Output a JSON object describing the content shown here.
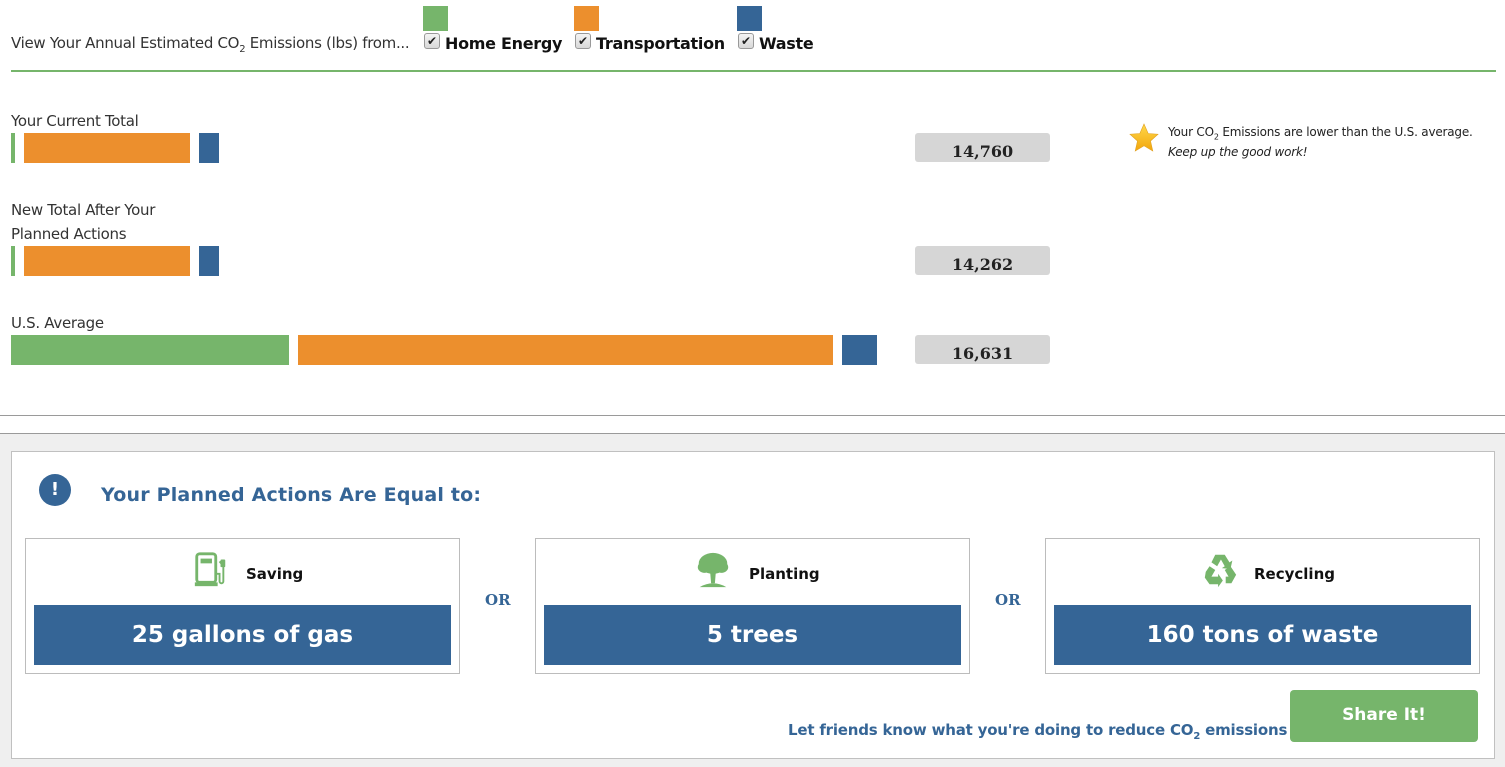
{
  "header": {
    "title_prefix": "View Your Annual Estimated CO",
    "title_sub": "2",
    "title_suffix": " Emissions (lbs) from...",
    "categories": [
      {
        "label": "Home Energy",
        "color": "#76b56b",
        "checked": true
      },
      {
        "label": "Transportation",
        "color": "#ec8f2d",
        "checked": true
      },
      {
        "label": "Waste",
        "color": "#356596",
        "checked": true
      }
    ],
    "checkmark": "✔"
  },
  "chart_data": {
    "type": "bar",
    "title": "Annual Estimated CO2 Emissions (lbs)",
    "series_names": [
      "Home Energy",
      "Transportation",
      "Waste"
    ],
    "colors": [
      "#76b56b",
      "#ec8f2d",
      "#356596"
    ],
    "rows": [
      {
        "label_lines": [
          "Your Current Total"
        ],
        "total": "14,760",
        "segments": [
          0.014,
          0.31,
          0.57
        ]
      },
      {
        "label_lines": [
          "New Total After Your",
          "Planned Actions"
        ],
        "total": "14,262",
        "segments": [
          0.014,
          0.31,
          0.57
        ]
      },
      {
        "label_lines": [
          "U.S. Average"
        ],
        "total": "16,631",
        "segments": [
          1.0,
          1.0,
          1.0
        ]
      }
    ],
    "segments_note": "segment lengths relative to U.S. average per category"
  },
  "note": {
    "line1_prefix": "Your CO",
    "line1_sub": "2",
    "line1_suffix": " Emissions are lower than the U.S. average.",
    "line2": "Keep up the good work!"
  },
  "equivalents": {
    "title": "Your Planned Actions Are Equal to:",
    "info_glyph": "!",
    "or_label": "OR",
    "cards": [
      {
        "icon": "gas-pump-icon",
        "caption": "Saving",
        "value": "25 gallons of gas"
      },
      {
        "icon": "tree-icon",
        "caption": "Planting",
        "value": "5 trees"
      },
      {
        "icon": "recycle-icon",
        "caption": "Recycling",
        "value": "160 tons of waste"
      }
    ],
    "share_prefix": "Let friends know what you're doing to reduce CO",
    "share_sub": "2",
    "share_suffix": " emissions",
    "share_button": "Share It!"
  }
}
